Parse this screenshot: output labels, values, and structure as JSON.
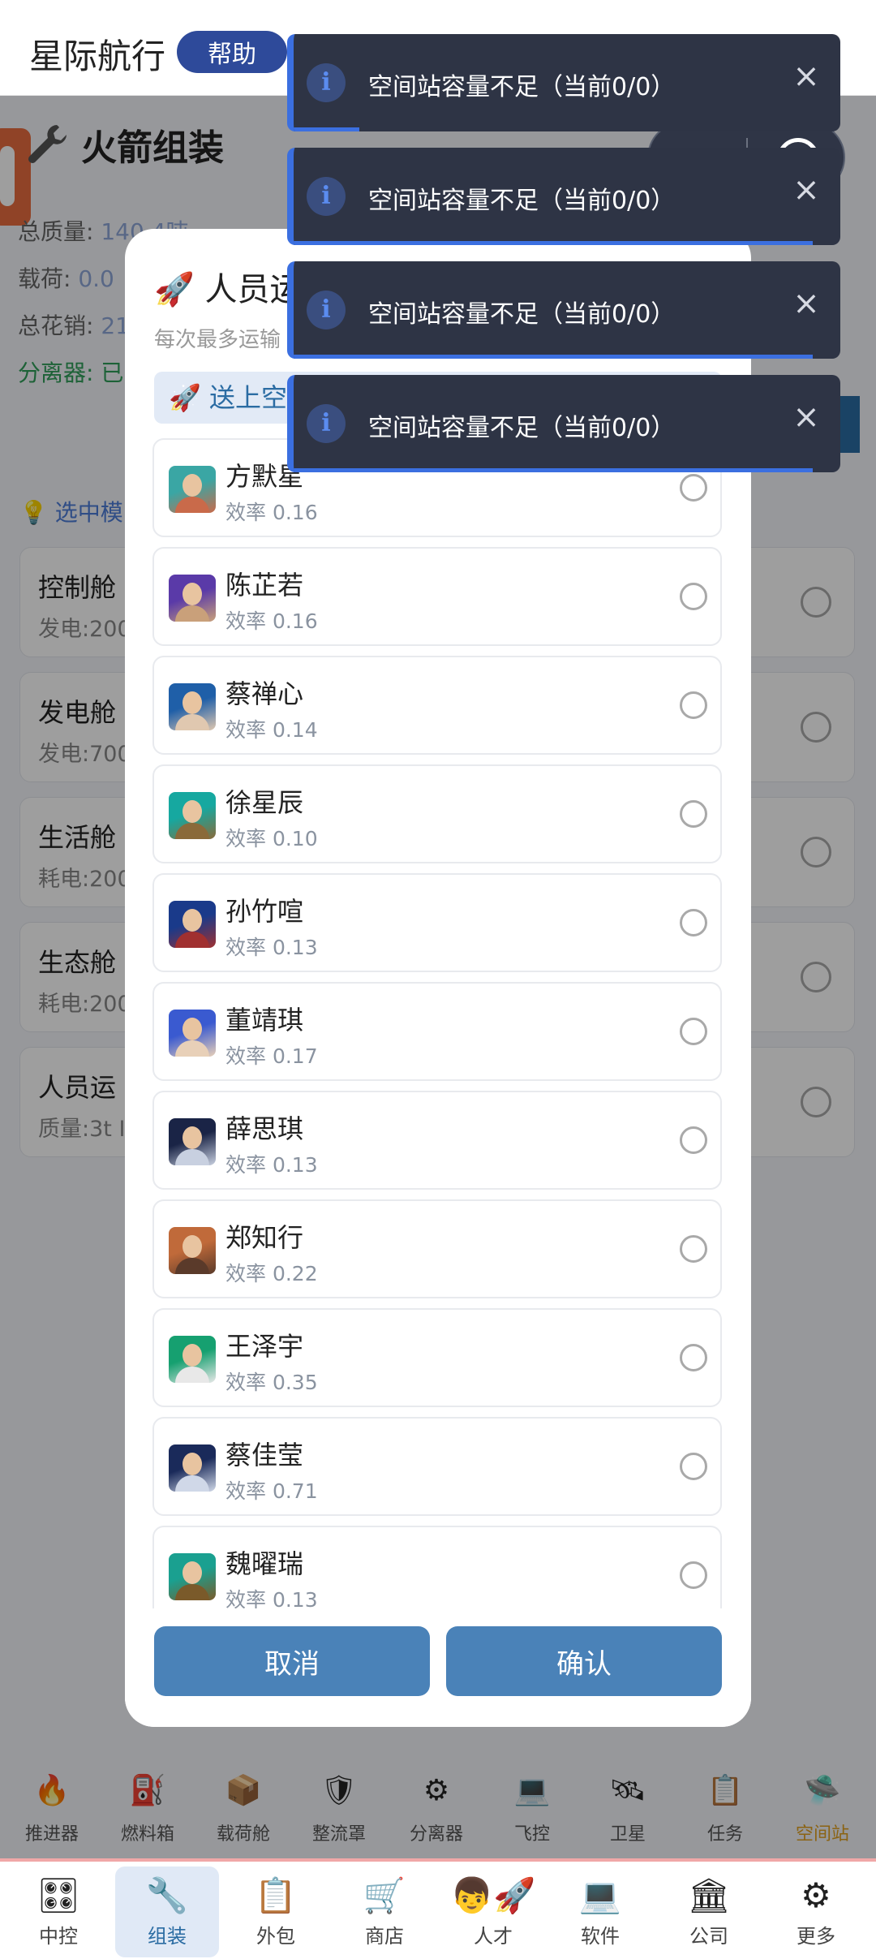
{
  "header": {
    "title": "星际航行",
    "help_label": "帮助"
  },
  "page": {
    "section_title": "火箭组装",
    "stats": [
      {
        "label": "总质量:",
        "value": "140.4吨"
      },
      {
        "label": "载荷:",
        "value": "0.0"
      },
      {
        "label": "总花销:",
        "value": "21"
      },
      {
        "label": "分离器: 已",
        "value": ""
      }
    ],
    "hint": "选中模",
    "modules": [
      {
        "name": "控制舱",
        "sub": "发电:200"
      },
      {
        "name": "发电舱",
        "sub": "发电:700"
      },
      {
        "name": "生活舱",
        "sub": "耗电:200"
      },
      {
        "name": "生态舱",
        "sub": "耗电:200"
      },
      {
        "name": "人员运",
        "sub": "质量:3t  I"
      }
    ]
  },
  "modal": {
    "title": "人员运输舱配置",
    "subtitle": "每次最多运输",
    "dest_tab": "送上空间站",
    "people": [
      {
        "name": "方默星",
        "efficiency": "效率 0.16",
        "colors": [
          "#3aa6a4",
          "#c96a4a"
        ]
      },
      {
        "name": "陈芷若",
        "efficiency": "效率 0.16",
        "colors": [
          "#5a3aa8",
          "#c9a07a"
        ]
      },
      {
        "name": "蔡禅心",
        "efficiency": "效率 0.14",
        "colors": [
          "#1f5fa8",
          "#e0c8b0"
        ]
      },
      {
        "name": "徐星辰",
        "efficiency": "效率 0.10",
        "colors": [
          "#16a8a0",
          "#8a6a3a"
        ]
      },
      {
        "name": "孙竹喧",
        "efficiency": "效率 0.13",
        "colors": [
          "#1a3a8a",
          "#a03030"
        ]
      },
      {
        "name": "董靖琪",
        "efficiency": "效率 0.17",
        "colors": [
          "#3a5ad0",
          "#e8d0b8"
        ]
      },
      {
        "name": "薛思琪",
        "efficiency": "效率 0.13",
        "colors": [
          "#1a2446",
          "#c8d0e0"
        ]
      },
      {
        "name": "郑知行",
        "efficiency": "效率 0.22",
        "colors": [
          "#c06a3a",
          "#5a3a2a"
        ]
      },
      {
        "name": "王泽宇",
        "efficiency": "效率 0.35",
        "colors": [
          "#16a070",
          "#e8e8e8"
        ]
      },
      {
        "name": "蔡佳莹",
        "efficiency": "效率 0.71",
        "colors": [
          "#1a2a5a",
          "#d0d8e8"
        ]
      },
      {
        "name": "魏曜瑞",
        "efficiency": "效率 0.13",
        "colors": [
          "#1aa090",
          "#7a5a2a"
        ]
      }
    ],
    "cancel_label": "取消",
    "confirm_label": "确认"
  },
  "toasts": [
    {
      "text": "空间站容量不足（当前0/0）",
      "progress": 0.12
    },
    {
      "text": "空间站容量不足（当前0/0）",
      "progress": 0.95
    },
    {
      "text": "空间站容量不足（当前0/0）",
      "progress": 0.95
    },
    {
      "text": "空间站容量不足（当前0/0）",
      "progress": 0.95
    }
  ],
  "toast_icon": "i",
  "toast_close": "×",
  "categories": [
    {
      "icon": "🔥",
      "label": "推进器"
    },
    {
      "icon": "⛽",
      "label": "燃料箱"
    },
    {
      "icon": "📦",
      "label": "载荷舱"
    },
    {
      "icon": "🛡",
      "label": "整流罩"
    },
    {
      "icon": "⚙",
      "label": "分离器"
    },
    {
      "icon": "💻",
      "label": "飞控"
    },
    {
      "icon": "🛰",
      "label": "卫星"
    },
    {
      "icon": "📋",
      "label": "任务"
    },
    {
      "icon": "🛸",
      "label": "空间站"
    }
  ],
  "bottom_nav": [
    {
      "icon": "🎛",
      "label": "中控",
      "active": false
    },
    {
      "icon": "🔧",
      "label": "组装",
      "active": true
    },
    {
      "icon": "📋",
      "label": "外包",
      "active": false
    },
    {
      "icon": "🛒",
      "label": "商店",
      "active": false
    },
    {
      "icon": "👦🚀",
      "label": "人才",
      "active": false
    },
    {
      "icon": "💻",
      "label": "软件",
      "active": false
    },
    {
      "icon": "🏛",
      "label": "公司",
      "active": false
    },
    {
      "icon": "⚙",
      "label": "更多",
      "active": false
    }
  ],
  "accent_color": "#2b6ca3",
  "toast_accent": "#3b6fe0"
}
